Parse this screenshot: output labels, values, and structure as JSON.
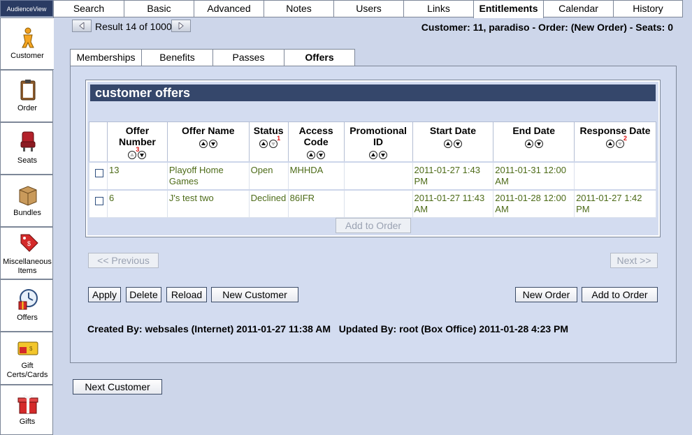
{
  "app": {
    "logo_text": "AudienceView"
  },
  "top_tabs": [
    "Search",
    "Basic",
    "Advanced",
    "Notes",
    "Users",
    "Links",
    "Entitlements",
    "Calendar",
    "History"
  ],
  "sidebar": {
    "items": [
      {
        "label": "Customer"
      },
      {
        "label": "Order"
      },
      {
        "label": "Seats"
      },
      {
        "label": "Bundles"
      },
      {
        "label": "Miscellaneous Items"
      },
      {
        "label": "Offers"
      },
      {
        "label": "Gift Certs/Cards"
      },
      {
        "label": "Gifts"
      }
    ]
  },
  "nav": {
    "result_text": "Result 14 of 1000"
  },
  "header": {
    "info": "Customer: 11, paradiso - Order: (New Order) - Seats: 0"
  },
  "sub_tabs": [
    "Memberships",
    "Benefits",
    "Passes",
    "Offers"
  ],
  "section": {
    "title": "customer offers"
  },
  "table": {
    "columns": [
      {
        "label": "Offer Number",
        "sort_marker": "3"
      },
      {
        "label": "Offer Name",
        "sort_marker": ""
      },
      {
        "label": "Status",
        "sort_marker": "1"
      },
      {
        "label": "Access Code",
        "sort_marker": ""
      },
      {
        "label": "Promotional ID",
        "sort_marker": ""
      },
      {
        "label": "Start Date",
        "sort_marker": ""
      },
      {
        "label": "End Date",
        "sort_marker": ""
      },
      {
        "label": "Response Date",
        "sort_marker": "2"
      }
    ],
    "rows": [
      {
        "offer_number": "13",
        "offer_name": "Playoff Home Games",
        "status": "Open",
        "access_code": "MHHDA",
        "promotional_id": "",
        "start_date": "2011-01-27 1:43 PM",
        "end_date": "2011-01-31 12:00 AM",
        "response_date": ""
      },
      {
        "offer_number": "6",
        "offer_name": "J's test two",
        "status": "Declined",
        "access_code": "86IFR",
        "promotional_id": "",
        "start_date": "2011-01-27 11:43 AM",
        "end_date": "2011-01-28 12:00 AM",
        "response_date": "2011-01-27 1:42 PM"
      }
    ],
    "add_to_order_label": "Add to Order"
  },
  "pager": {
    "previous_label": "<< Previous",
    "next_label": "Next >>"
  },
  "actions": {
    "apply": "Apply",
    "delete": "Delete",
    "reload": "Reload",
    "new_customer": "New Customer",
    "new_order": "New Order",
    "add_to_order": "Add to Order",
    "next_customer": "Next Customer"
  },
  "audit": {
    "text": "Created By: websales (Internet) 2011-01-27 11:38 AM   Updated By: root (Box Office) 2011-01-28 4:23 PM"
  },
  "colors": {
    "accent": "#35476b",
    "background": "#cdd6ea",
    "data_text": "#4d6b18",
    "sort_marker": "#e01010"
  }
}
